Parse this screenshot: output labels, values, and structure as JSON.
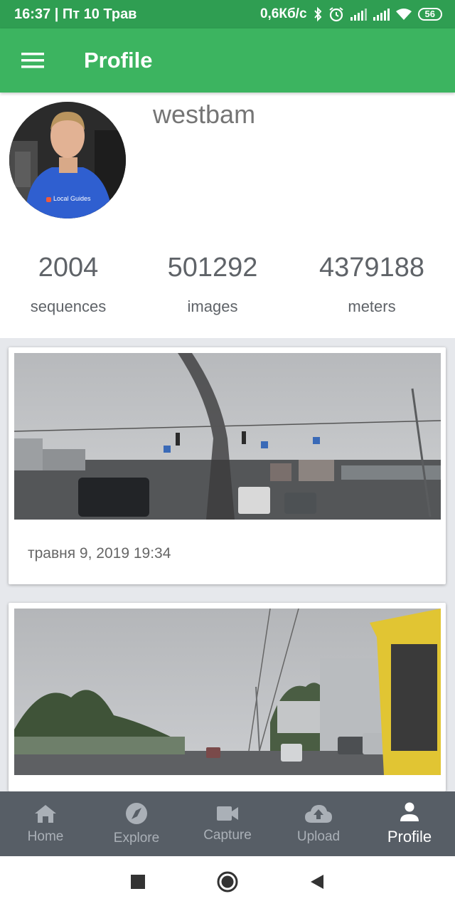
{
  "status_bar": {
    "time_date": "16:37 | Пт 10 Трав",
    "network_speed": "0,6Кб/с",
    "battery": "56",
    "icons": [
      "bluetooth-icon",
      "alarm-icon",
      "signal-icon",
      "signal-icon",
      "wifi-icon",
      "battery-icon"
    ]
  },
  "app_bar": {
    "title": "Profile",
    "menu_icon": "hamburger-menu-icon"
  },
  "profile": {
    "username": "westbam",
    "avatar_badge": "Local Guides",
    "stats": [
      {
        "value": "2004",
        "label": "sequences"
      },
      {
        "value": "501292",
        "label": "images"
      },
      {
        "value": "4379188",
        "label": "meters"
      }
    ]
  },
  "sequences": [
    {
      "date": "травня 9, 2019 19:34"
    },
    {
      "date": ""
    }
  ],
  "bottom_nav": [
    {
      "label": "Home",
      "icon": "home-icon",
      "active": false
    },
    {
      "label": "Explore",
      "icon": "compass-icon",
      "active": false
    },
    {
      "label": "Capture",
      "icon": "videocam-icon",
      "active": false
    },
    {
      "label": "Upload",
      "icon": "cloud-upload-icon",
      "active": false
    },
    {
      "label": "Profile",
      "icon": "person-icon",
      "active": true
    }
  ],
  "colors": {
    "status_bar": "#2f9e52",
    "app_bar": "#3cb460",
    "bottom_nav": "#575e66",
    "nav_inactive": "#aab0b7",
    "nav_active": "#ffffff"
  }
}
